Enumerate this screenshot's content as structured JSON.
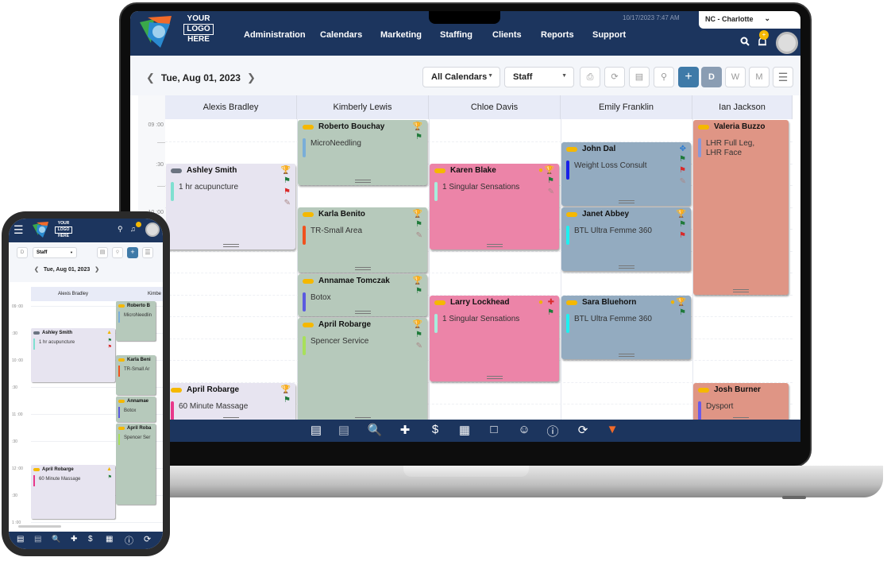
{
  "header": {
    "logo_text": [
      "YOUR",
      "LOGO",
      "HERE"
    ],
    "nav": [
      "Administration",
      "Calendars",
      "Marketing",
      "Staffing",
      "Clients",
      "Reports",
      "Support"
    ],
    "datetime": "10/17/2023 7:47 AM",
    "location": "NC - Charlotte",
    "notification_badge": "+"
  },
  "toolbar": {
    "date": "Tue, Aug 01, 2023",
    "calendar_filter": "All Calendars",
    "view_by": "Staff",
    "view_buttons": [
      "D",
      "W",
      "M"
    ],
    "active_view": "D",
    "add_label": "+"
  },
  "time_labels": [
    "09 :00",
    ":30",
    "10 :00"
  ],
  "staff": [
    "Alexis Bradley",
    "Kimberly Lewis",
    "Chloe Davis",
    "Emily Franklin",
    "Ian Jackson"
  ],
  "appointments": [
    {
      "client": "Ashley Smith",
      "service": "1 hr acupuncture",
      "staff": "Alexis Bradley",
      "color": "#e7e4f0",
      "bar": "#7fe0d0",
      "status": "gray",
      "icons": [
        "trophy",
        "flag-green",
        "flag-red",
        "note"
      ]
    },
    {
      "client": "April Robarge",
      "service": "60 Minute Massage",
      "staff": "Alexis Bradley",
      "color": "#e7e4f0",
      "bar": "#e8388a",
      "status": "yellow",
      "icons": [
        "trophy",
        "flag-green"
      ]
    },
    {
      "client": "Roberto Bouchay",
      "service": "MicroNeedling",
      "staff": "Kimberly Lewis",
      "color": "#b6c9bb",
      "bar": "#7aaed8",
      "status": "yellow",
      "icons": [
        "trophy",
        "flag-green"
      ]
    },
    {
      "client": "Karla Benito",
      "service": "TR-Small Area",
      "staff": "Kimberly Lewis",
      "color": "#b6c9bb",
      "bar": "#f0521e",
      "status": "yellow",
      "icons": [
        "trophy",
        "flag-green",
        "note"
      ]
    },
    {
      "client": "Annamae Tomczak",
      "service": "Botox",
      "staff": "Kimberly Lewis",
      "color": "#b6c9bb",
      "bar": "#5a5ae0",
      "status": "yellow",
      "icons": [
        "trophy",
        "flag-green"
      ]
    },
    {
      "client": "April Robarge",
      "service": "Spencer Service",
      "staff": "Kimberly Lewis",
      "color": "#b6c9bb",
      "bar": "#a8e05a",
      "status": "yellow",
      "icons": [
        "trophy",
        "flag-green",
        "note"
      ]
    },
    {
      "client": "Karen Blake",
      "service": "1 Singular Sensations",
      "staff": "Chloe Davis",
      "color": "#ec84a8",
      "bar": "#a8ecdc",
      "status": "yellow",
      "icons": [
        "membership",
        "trophy",
        "flag-green",
        "note"
      ]
    },
    {
      "client": "Larry Lockhead",
      "service": "1 Singular Sensations",
      "staff": "Chloe Davis",
      "color": "#ec84a8",
      "bar": "#a8ecdc",
      "status": "yellow",
      "icons": [
        "membership",
        "medical-plus",
        "flag-green"
      ]
    },
    {
      "client": "John Dal",
      "service": "Weight Loss Consult",
      "staff": "Emily Franklin",
      "color": "#93abc0",
      "bar": "#1820e8",
      "status": "yellow",
      "icons": [
        "footprints",
        "flag-green",
        "flag-red",
        "note"
      ]
    },
    {
      "client": "Janet Abbey",
      "service": "BTL Ultra Femme 360",
      "staff": "Emily Franklin",
      "color": "#93abc0",
      "bar": "#1ef0f0",
      "status": "yellow",
      "icons": [
        "trophy",
        "flag-green",
        "flag-red"
      ]
    },
    {
      "client": "Sara Bluehorn",
      "service": "BTL Ultra Femme 360",
      "staff": "Emily Franklin",
      "color": "#93abc0",
      "bar": "#1ef0f0",
      "status": "yellow",
      "icons": [
        "membership",
        "trophy-gray",
        "flag-green"
      ]
    },
    {
      "client": "Valeria Buzzo",
      "service": "LHR Full Leg,\nLHR Face",
      "staff": "Ian Jackson",
      "color": "#df9585",
      "bar": "#8a98d8",
      "status": "yellow",
      "icons": []
    },
    {
      "client": "Josh Burner",
      "service": "Dysport",
      "staff": "Ian Jackson",
      "color": "#df9585",
      "bar": "#6a5ae8",
      "status": "yellow",
      "icons": []
    }
  ],
  "bottom_icons": [
    "calendar-back-icon",
    "calendar-forward-icon",
    "client-search-icon",
    "add-client-icon",
    "invoice-add-icon",
    "calendar-add-icon",
    "window-icon",
    "support-agent-icon",
    "help-icon",
    "refresh-icon",
    "brand-logo-icon"
  ],
  "phone": {
    "view_button": "D",
    "view_by": "Staff",
    "date": "Tue, Aug 01, 2023",
    "staff": [
      "Alexis Bradley",
      "Kimbe"
    ],
    "time_labels": [
      "09 :00",
      ":30",
      "10 :00",
      ":30",
      "11 :00",
      ":30",
      "12 :00",
      ":30",
      "1 :00"
    ],
    "appointments": [
      {
        "client": "Ashley Smith",
        "service": "1 hr acupuncture"
      },
      {
        "client": "April Robarge",
        "service": "60 Minute Massage"
      },
      {
        "client": "Roberto B",
        "service": "MicroNeedlin"
      },
      {
        "client": "Karla Beni",
        "service": "TR-Small Ar"
      },
      {
        "client": "Annamae",
        "service": "Botox"
      },
      {
        "client": "April Roba",
        "service": "Spencer Ser"
      }
    ]
  }
}
